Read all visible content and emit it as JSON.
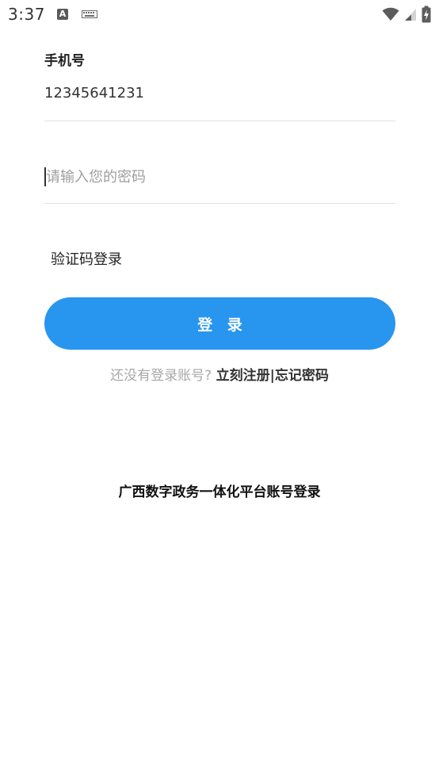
{
  "status_bar": {
    "time": "3:37",
    "notification_icon": "a-box-icon",
    "keyboard_icon": "keyboard-icon",
    "wifi_icon": "wifi-icon",
    "signal_icon": "signal-icon",
    "battery_icon": "battery-charging-icon"
  },
  "form": {
    "phone_label": "手机号",
    "phone_value": "12345641231",
    "password_placeholder": "请输入您的密码",
    "sms_login_label": "验证码登录",
    "login_button_label": "登 录",
    "register_prompt": "还没有登录账号?",
    "register_link": "立刻注册",
    "separator": "|",
    "forgot_password_link": "忘记密码"
  },
  "platform_login_label": "广西数字政务一体化平台账号登录",
  "colors": {
    "accent": "#2895ef",
    "muted_text": "#a8a8a8",
    "divider": "#e0e0e0"
  }
}
